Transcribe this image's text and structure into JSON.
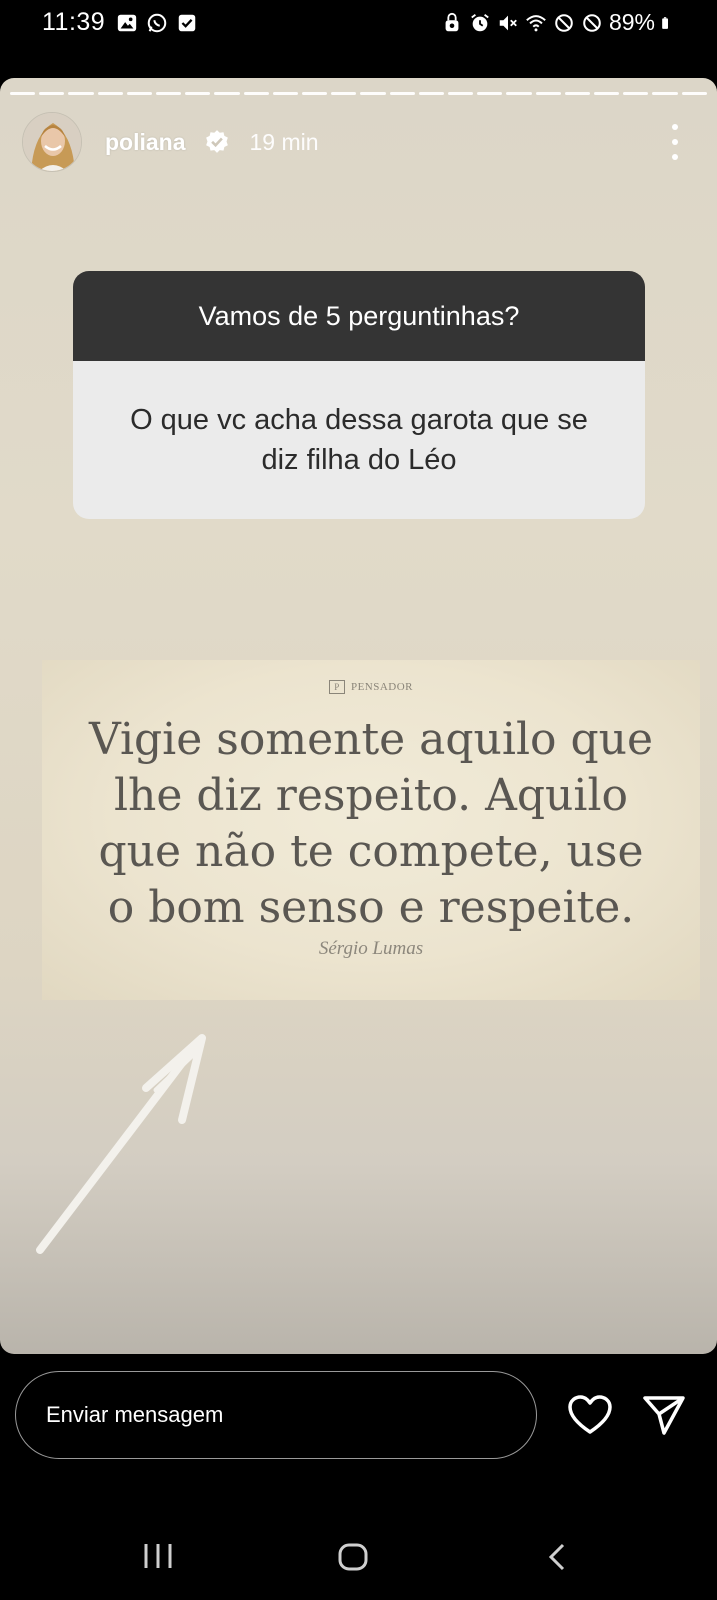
{
  "status_bar": {
    "time": "11:39",
    "battery_percent": "89%"
  },
  "story": {
    "username": "poliana",
    "time_ago": "19 min",
    "progress": {
      "segments": 24,
      "current": 24
    },
    "question_sticker": {
      "question": "Vamos de 5 perguntinhas?",
      "answer": "O que vc acha dessa garota que se diz filha do Léo"
    },
    "quote_image": {
      "brand": "PENSADOR",
      "lines": [
        "Vigie somente aquilo que",
        "lhe diz respeito. Aquilo",
        "que não te compete, use",
        "o bom senso e respeite."
      ],
      "author": "Sérgio Lumas"
    }
  },
  "reply_bar": {
    "placeholder": "Enviar mensagem"
  },
  "colors": {
    "story_background": "#dcd6c8",
    "question_header": "#343434",
    "question_body": "#ebebeb"
  }
}
